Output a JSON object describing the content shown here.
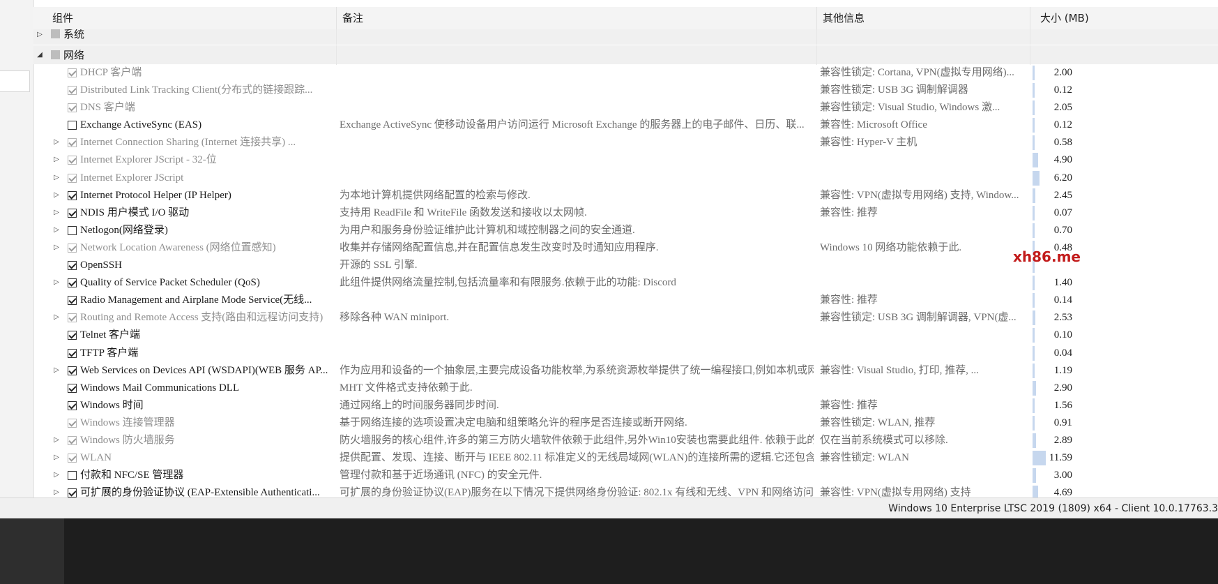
{
  "columns": {
    "component": "组件",
    "note": "备注",
    "info": "其他信息",
    "size": "大小 (MB)"
  },
  "groups": [
    {
      "name": "系统",
      "expanded": false
    },
    {
      "name": "网络",
      "expanded": true
    }
  ],
  "rows": [
    {
      "name": "DHCP 客户端",
      "note": "",
      "info": "兼容性锁定: Cortana, VPN(虚拟专用网络)...",
      "size": "2.00",
      "size_value": 2.0,
      "checked": true,
      "enabled": false,
      "expandable": false
    },
    {
      "name": "Distributed Link Tracking Client(分布式的链接跟踪...",
      "note": "",
      "info": "兼容性锁定: USB 3G 调制解调器",
      "size": "0.12",
      "size_value": 0.12,
      "checked": true,
      "enabled": false,
      "expandable": false
    },
    {
      "name": "DNS 客户端",
      "note": "",
      "info": "兼容性锁定: Visual Studio, Windows 激...",
      "size": "2.05",
      "size_value": 2.05,
      "checked": true,
      "enabled": false,
      "expandable": false
    },
    {
      "name": "Exchange ActiveSync (EAS)",
      "note": "Exchange ActiveSync 使移动设备用户访问运行 Microsoft Exchange 的服务器上的电子邮件、日历、联...",
      "info": "兼容性: Microsoft Office",
      "size": "0.12",
      "size_value": 0.12,
      "checked": false,
      "enabled": true,
      "expandable": false
    },
    {
      "name": "Internet Connection Sharing (Internet 连接共享) ...",
      "note": "",
      "info": "兼容性: Hyper-V 主机",
      "size": "0.58",
      "size_value": 0.58,
      "checked": true,
      "enabled": false,
      "expandable": true
    },
    {
      "name": "Internet Explorer JScript - 32-位",
      "note": "",
      "info": "",
      "size": "4.90",
      "size_value": 4.9,
      "checked": true,
      "enabled": false,
      "expandable": true
    },
    {
      "name": "Internet Explorer JScript",
      "note": "",
      "info": "",
      "size": "6.20",
      "size_value": 6.2,
      "checked": true,
      "enabled": false,
      "expandable": true
    },
    {
      "name": "Internet Protocol Helper (IP Helper)",
      "note": "为本地计算机提供网络配置的检索与修改.",
      "info": "兼容性: VPN(虚拟专用网络) 支持, Window...",
      "size": "2.45",
      "size_value": 2.45,
      "checked": true,
      "enabled": true,
      "expandable": true
    },
    {
      "name": "NDIS 用户模式 I/O 驱动",
      "note": "支持用 ReadFile 和 WriteFile 函数发送和接收以太网帧.",
      "info": "兼容性: 推荐",
      "size": "0.07",
      "size_value": 0.07,
      "checked": true,
      "enabled": true,
      "expandable": true
    },
    {
      "name": "Netlogon(网络登录)",
      "note": "为用户和服务身份验证维护此计算机和域控制器之间的安全通道.",
      "info": "",
      "size": "0.70",
      "size_value": 0.7,
      "checked": false,
      "enabled": true,
      "expandable": true
    },
    {
      "name": "Network Location Awareness (网络位置感知)",
      "note": "收集并存储网络配置信息,并在配置信息发生改变时及时通知应用程序.",
      "info": "Windows 10 网络功能依赖于此.",
      "size": "0.48",
      "size_value": 0.48,
      "checked": true,
      "enabled": false,
      "expandable": true
    },
    {
      "name": "OpenSSH",
      "note": "开源的 SSL 引擎.",
      "info": "",
      "size": "",
      "size_value": 0.1,
      "checked": true,
      "enabled": true,
      "expandable": false
    },
    {
      "name": "Quality of Service Packet Scheduler (QoS)",
      "note": "此组件提供网络流量控制,包括流量率和有限服务.依赖于此的功能: Discord",
      "info": "",
      "size": "1.40",
      "size_value": 1.4,
      "checked": true,
      "enabled": true,
      "expandable": true
    },
    {
      "name": "Radio Management and Airplane Mode Service(无线...",
      "note": "",
      "info": "兼容性: 推荐",
      "size": "0.14",
      "size_value": 0.14,
      "checked": true,
      "enabled": true,
      "expandable": false
    },
    {
      "name": "Routing and Remote Access 支持(路由和远程访问支持)",
      "note": "移除各种 WAN miniport.",
      "info": "兼容性锁定: USB 3G 调制解调器, VPN(虚...",
      "size": "2.53",
      "size_value": 2.53,
      "checked": true,
      "enabled": false,
      "expandable": true
    },
    {
      "name": "Telnet 客户端",
      "note": "",
      "info": "",
      "size": "0.10",
      "size_value": 0.1,
      "checked": true,
      "enabled": true,
      "expandable": false
    },
    {
      "name": "TFTP 客户端",
      "note": "",
      "info": "",
      "size": "0.04",
      "size_value": 0.04,
      "checked": true,
      "enabled": true,
      "expandable": false
    },
    {
      "name": "Web Services on Devices API (WSDAPI)(WEB 服务 AP...",
      "note": "作为应用和设备的一个抽象层,主要完成设备功能枚举,为系统资源枚举提供了统一编程接口,例如本机或网...",
      "info": "兼容性: Visual Studio, 打印, 推荐, ...",
      "size": "1.19",
      "size_value": 1.19,
      "checked": true,
      "enabled": true,
      "expandable": true
    },
    {
      "name": "Windows Mail Communications DLL",
      "note": "MHT 文件格式支持依赖于此.",
      "info": "",
      "size": "2.90",
      "size_value": 2.9,
      "checked": true,
      "enabled": true,
      "expandable": false
    },
    {
      "name": "Windows 时间",
      "note": "通过网络上的时间服务器同步时间.",
      "info": "兼容性: 推荐",
      "size": "1.56",
      "size_value": 1.56,
      "checked": true,
      "enabled": true,
      "expandable": false
    },
    {
      "name": "Windows 连接管理器",
      "note": "基于网络连接的选项设置决定电脑和组策略允许的程序是否连接或断开网络.",
      "info": "兼容性锁定: WLAN, 推荐",
      "size": "0.91",
      "size_value": 0.91,
      "checked": true,
      "enabled": false,
      "expandable": false
    },
    {
      "name": "Windows 防火墙服务",
      "note": "防火墙服务的核心组件,许多的第三方防火墙软件依赖于此组件,另外Win10安装也需要此组件. 依赖于此的功...",
      "info": "仅在当前系统模式可以移除.",
      "size": "2.89",
      "size_value": 2.89,
      "checked": true,
      "enabled": false,
      "expandable": true
    },
    {
      "name": "WLAN",
      "note": "提供配置、发现、连接、断开与 IEEE 802.11 标准定义的无线局域网(WLAN)的连接所需的逻辑.它还包含将计...",
      "info": "兼容性锁定: WLAN",
      "size": "11.59",
      "size_value": 11.59,
      "checked": true,
      "enabled": false,
      "expandable": true
    },
    {
      "name": "付款和 NFC/SE 管理器",
      "note": "管理付款和基于近场通讯 (NFC) 的安全元件.",
      "info": "",
      "size": "3.00",
      "size_value": 3.0,
      "checked": false,
      "enabled": true,
      "expandable": true
    },
    {
      "name": "可扩展的身份验证协议 (EAP-Extensible Authenticati...",
      "note": "可扩展的身份验证协议(EAP)服务在以下情况下提供网络身份验证: 802.1x 有线和无线、VPN 和网络访问保护...",
      "info": "兼容性: VPN(虚拟专用网络) 支持",
      "size": "4.69",
      "size_value": 4.69,
      "checked": true,
      "enabled": true,
      "expandable": true
    }
  ],
  "size_bar_max": 11.59,
  "status": {
    "text": "Windows 10 Enterprise LTSC 2019 (1809) x64 - Client 10.0.17763.3"
  },
  "watermark": "xh86.me",
  "colors": {
    "size_bar": "#c6d7ee",
    "header_bg": "#f4f4f4",
    "group_bg": "#f0f0f0",
    "watermark": "#c21b1b"
  }
}
